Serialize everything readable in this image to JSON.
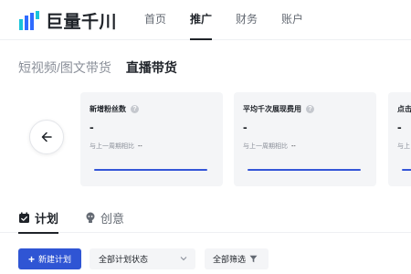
{
  "header": {
    "brand": "巨量千川",
    "nav": [
      "首页",
      "推广",
      "财务",
      "账户"
    ],
    "active_nav": "推广"
  },
  "page_tabs": [
    "短视频/图文带货",
    "直播带货"
  ],
  "metrics": [
    {
      "title": "新增粉丝数",
      "value": "-",
      "compare_label": "与上一周期相比",
      "compare_value": "--"
    },
    {
      "title": "平均千次展现费用",
      "value": "-",
      "compare_label": "与上一周期相比",
      "compare_value": "--"
    },
    {
      "title": "点击",
      "value": "-",
      "compare_label": "与上",
      "compare_value": ""
    }
  ],
  "sub_tabs": [
    "计划",
    "创意"
  ],
  "toolbar": {
    "new_plan": "新建计划",
    "status_select": "全部计划状态",
    "filter": "全部筛选"
  },
  "colors": {
    "accent": "#2f55d4",
    "logo_blue": "#2f6bff",
    "logo_cyan": "#19c4d9"
  }
}
